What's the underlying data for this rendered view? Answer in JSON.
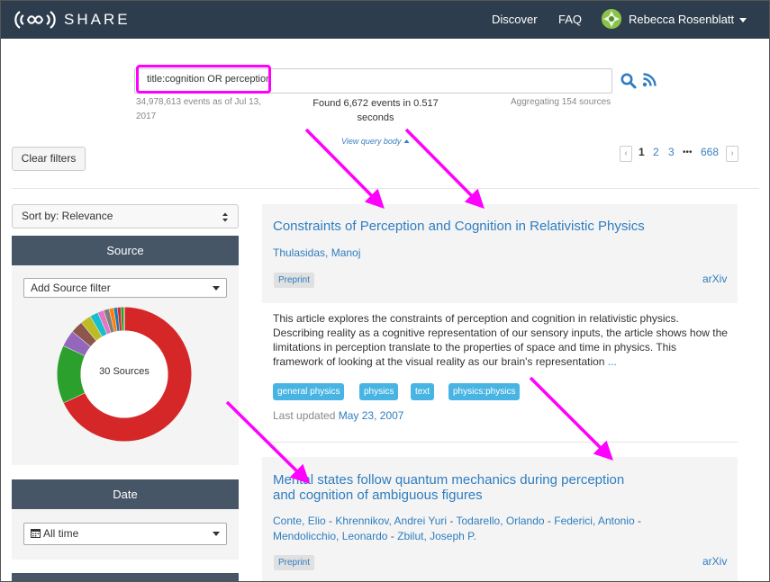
{
  "navbar": {
    "brand": "SHARE",
    "discover": "Discover",
    "faq": "FAQ",
    "user_name": "Rebecca Rosenblatt"
  },
  "search": {
    "query": "title:cognition OR perception",
    "events_count": "34,978,613 events as of Jul 13,",
    "events_year": "2017",
    "found_line1": "Found 6,672 events in 0.517",
    "found_line2": "seconds",
    "aggregating": "Aggregating 154 sources",
    "view_query": "View query body"
  },
  "filters": {
    "clear_label": "Clear filters"
  },
  "pagination": {
    "pages": [
      "1",
      "2",
      "3",
      "•••",
      "668"
    ],
    "current": "1",
    "prev": "‹",
    "next": "›"
  },
  "sidebar": {
    "sort_label": "Sort by: Relevance",
    "source_title": "Source",
    "source_filter": "Add Source filter",
    "donut_center": "30 Sources",
    "date_title": "Date",
    "date_value": "All time"
  },
  "results": [
    {
      "title": "Constraints of Perception and Cognition in Relativistic Physics",
      "authors": [
        "Thulasidas, Manoj"
      ],
      "type": "Preprint",
      "source": "arXiv",
      "description": "This article explores the constraints of perception and cognition in relativistic physics. Describing reality as a cognitive representation of our sensory inputs, the article shows how the limitations in perception translate to the properties of space and time in physics. This framework of looking at the visual reality as our brain's representation",
      "ellipsis": "...",
      "tags": [
        "general physics",
        "physics",
        "text",
        "physics:physics"
      ],
      "updated_label": "Last updated",
      "updated_date": "May 23, 2007"
    },
    {
      "title_line1": "Mental states follow quantum mechanics during perception",
      "title_line2": "and cognition of ambiguous figures",
      "authors_line1": [
        "Conte, Elio",
        "Khrennikov, Andrei Yuri",
        "Todarello, Orlando",
        "Federici, Antonio"
      ],
      "authors_line2": [
        "Mendolicchio, Leonardo",
        "Zbilut, Joseph P."
      ],
      "separator": "-",
      "type": "Preprint",
      "source": "arXiv"
    }
  ],
  "colors": {
    "navbar": "#2e3d4d",
    "link": "#2f7dbf",
    "highlight": "#ff00ff",
    "tag": "#48b4e3",
    "donut": [
      "#d62728",
      "#2ca02c",
      "#9467bd",
      "#8c564b",
      "#bcbd22",
      "#17becf",
      "#e377c2",
      "#7f7f7f",
      "#ff7f0e",
      "#1f77b4"
    ]
  },
  "donut_values": [
    68,
    14,
    4,
    3,
    2.6,
    2,
    1.5,
    1.3,
    1.1,
    0.9,
    0.8,
    0.8
  ]
}
